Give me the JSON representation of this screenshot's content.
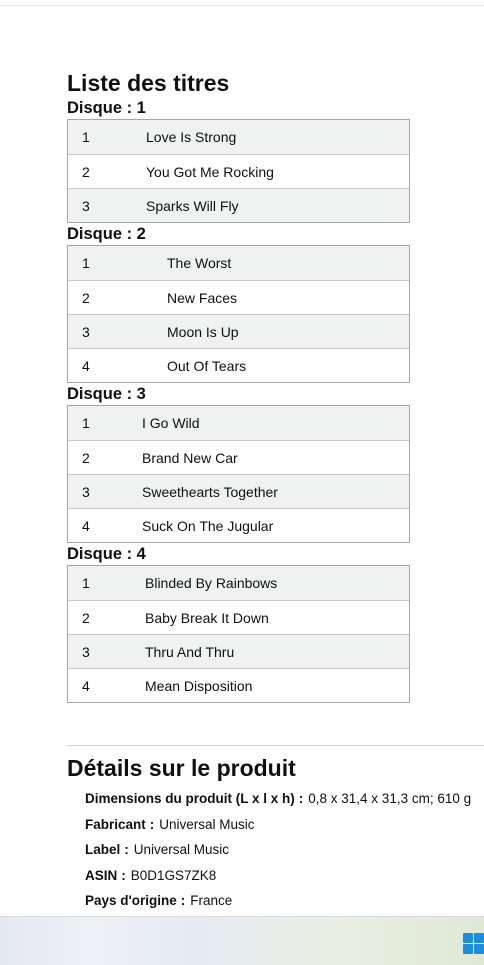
{
  "tracklist": {
    "title": "Liste des titres",
    "discs": [
      {
        "label": "Disque : 1",
        "tracks": [
          {
            "num": "1",
            "title": "Love Is Strong"
          },
          {
            "num": "2",
            "title": "You Got Me Rocking"
          },
          {
            "num": "3",
            "title": "Sparks Will Fly"
          }
        ]
      },
      {
        "label": "Disque : 2",
        "tracks": [
          {
            "num": "1",
            "title": "The Worst"
          },
          {
            "num": "2",
            "title": "New Faces"
          },
          {
            "num": "3",
            "title": "Moon Is Up"
          },
          {
            "num": "4",
            "title": "Out Of Tears"
          }
        ]
      },
      {
        "label": "Disque : 3",
        "tracks": [
          {
            "num": "1",
            "title": "I Go Wild"
          },
          {
            "num": "2",
            "title": "Brand New Car"
          },
          {
            "num": "3",
            "title": "Sweethearts Together"
          },
          {
            "num": "4",
            "title": "Suck On The Jugular"
          }
        ]
      },
      {
        "label": "Disque : 4",
        "tracks": [
          {
            "num": "1",
            "title": "Blinded By Rainbows"
          },
          {
            "num": "2",
            "title": "Baby Break It Down"
          },
          {
            "num": "3",
            "title": "Thru And Thru"
          },
          {
            "num": "4",
            "title": "Mean Disposition"
          }
        ]
      }
    ]
  },
  "details": {
    "title": "Détails sur le produit",
    "separator": ":",
    "items": [
      {
        "label": "Dimensions du produit (L x l x h)",
        "value": "0,8 x 31,4 x 31,3 cm; 610 g"
      },
      {
        "label": "Fabricant",
        "value": "Universal Music"
      },
      {
        "label": "Label",
        "value": "Universal Music"
      },
      {
        "label": "ASIN",
        "value": "B0D1GS7ZK8"
      },
      {
        "label": "Pays d'origine",
        "value": "France"
      }
    ]
  },
  "taskbar": {
    "start_icon": "windows-start-icon"
  }
}
